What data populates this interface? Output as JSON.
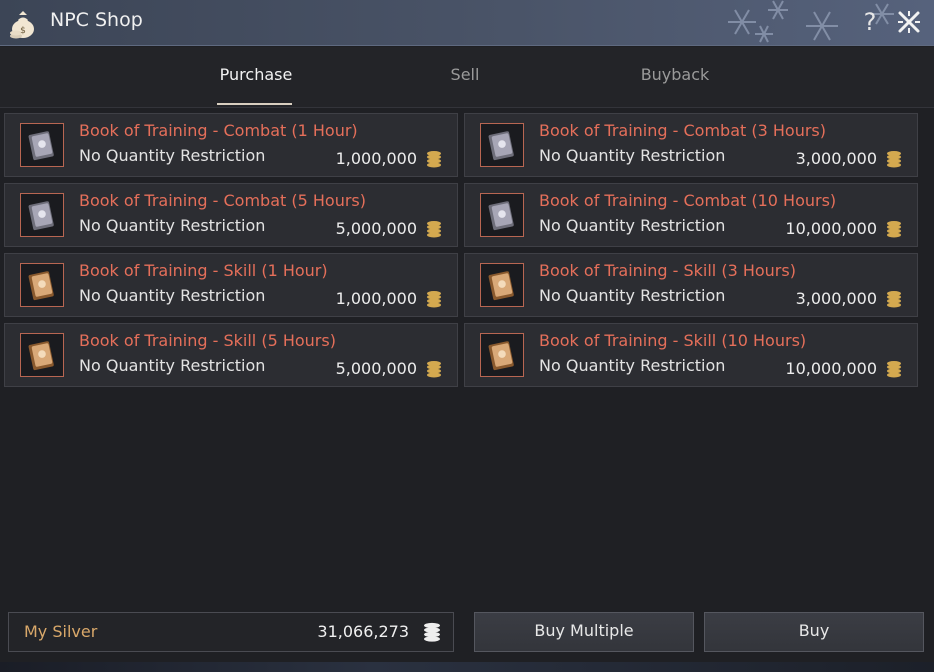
{
  "window": {
    "title": "NPC Shop",
    "help_label": "?"
  },
  "tabs": [
    {
      "label": "Purchase",
      "active": true
    },
    {
      "label": "Sell",
      "active": false
    },
    {
      "label": "Buyback",
      "active": false
    }
  ],
  "items": [
    {
      "name": "Book of Training - Combat (1 Hour)",
      "restriction": "No Quantity Restriction",
      "price": "1,000,000",
      "icon": "combat-book-icon"
    },
    {
      "name": "Book of Training - Combat (3 Hours)",
      "restriction": "No Quantity Restriction",
      "price": "3,000,000",
      "icon": "combat-book-icon"
    },
    {
      "name": "Book of Training - Combat (5 Hours)",
      "restriction": "No Quantity Restriction",
      "price": "5,000,000",
      "icon": "combat-book-icon"
    },
    {
      "name": "Book of Training - Combat (10 Hours)",
      "restriction": "No Quantity Restriction",
      "price": "10,000,000",
      "icon": "combat-book-icon"
    },
    {
      "name": "Book of Training - Skill (1 Hour)",
      "restriction": "No Quantity Restriction",
      "price": "1,000,000",
      "icon": "skill-book-icon"
    },
    {
      "name": "Book of Training - Skill (3 Hours)",
      "restriction": "No Quantity Restriction",
      "price": "3,000,000",
      "icon": "skill-book-icon"
    },
    {
      "name": "Book of Training - Skill (5 Hours)",
      "restriction": "No Quantity Restriction",
      "price": "5,000,000",
      "icon": "skill-book-icon"
    },
    {
      "name": "Book of Training - Skill (10 Hours)",
      "restriction": "No Quantity Restriction",
      "price": "10,000,000",
      "icon": "skill-book-icon"
    }
  ],
  "footer": {
    "silver_label": "My Silver",
    "silver_value": "31,066,273",
    "buy_multiple_label": "Buy Multiple",
    "buy_label": "Buy"
  },
  "colors": {
    "item_name": "#e56f5a",
    "silver_label": "#d9a86a",
    "coin": "#d4a94f"
  }
}
